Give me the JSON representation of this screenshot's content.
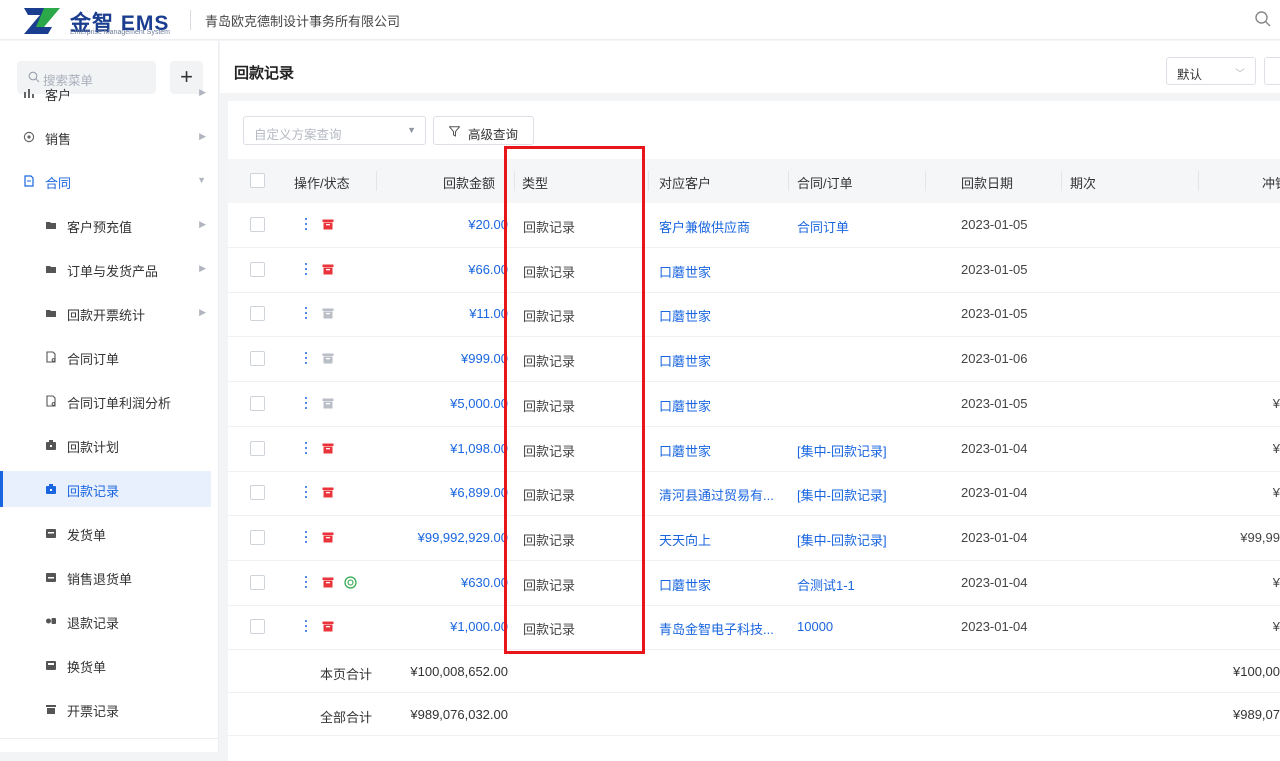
{
  "app": {
    "logo_title": "金智 EMS",
    "logo_subtitle": "Enterprise Management System",
    "company": "青岛欧克德制设计事务所有限公司"
  },
  "sidebar": {
    "search_placeholder": "搜索菜单",
    "items": [
      {
        "label": "客户",
        "level": 1,
        "icon": "customer-icon",
        "arrow": true
      },
      {
        "label": "销售",
        "level": 1,
        "icon": "sales-icon",
        "arrow": true
      },
      {
        "label": "合同",
        "level": 1,
        "icon": "contract-icon",
        "arrow": true,
        "expanded": true
      },
      {
        "label": "客户预充值",
        "level": 2,
        "icon": "folder-icon",
        "arrow": true
      },
      {
        "label": "订单与发货产品",
        "level": 2,
        "icon": "folder-icon",
        "arrow": true
      },
      {
        "label": "回款开票统计",
        "level": 2,
        "icon": "folder-icon",
        "arrow": true
      },
      {
        "label": "合同订单",
        "level": 2,
        "icon": "document-icon"
      },
      {
        "label": "合同订单利润分析",
        "level": 2,
        "icon": "document-icon"
      },
      {
        "label": "回款计划",
        "level": 2,
        "icon": "payment-plan-icon"
      },
      {
        "label": "回款记录",
        "level": 2,
        "icon": "payment-record-icon",
        "active": true
      },
      {
        "label": "发货单",
        "level": 2,
        "icon": "shipment-icon"
      },
      {
        "label": "销售退货单",
        "level": 2,
        "icon": "return-icon"
      },
      {
        "label": "退款记录",
        "level": 2,
        "icon": "refund-icon"
      },
      {
        "label": "换货单",
        "level": 2,
        "icon": "exchange-icon"
      },
      {
        "label": "开票记录",
        "level": 2,
        "icon": "invoice-icon"
      }
    ]
  },
  "page": {
    "title": "回款记录",
    "view_select": "默认",
    "filter_placeholder": "自定义方案查询",
    "advanced_search": "高级查询"
  },
  "table": {
    "headers": {
      "ops": "操作/状态",
      "amount": "回款金额",
      "type": "类型",
      "customer": "对应客户",
      "contract": "合同/订单",
      "date": "回款日期",
      "period": "期次",
      "offset": "冲销"
    },
    "rows": [
      {
        "amount": "¥20.00",
        "type": "回款记录",
        "customer": "客户兼做供应商",
        "contract": "合同订单",
        "date": "2023-01-05",
        "offset": "",
        "status": "red",
        "extra": false
      },
      {
        "amount": "¥66.00",
        "type": "回款记录",
        "customer": "口蘑世家",
        "contract": "",
        "date": "2023-01-05",
        "offset": "",
        "status": "red",
        "extra": false
      },
      {
        "amount": "¥11.00",
        "type": "回款记录",
        "customer": "口蘑世家",
        "contract": "",
        "date": "2023-01-05",
        "offset": "",
        "status": "gray",
        "extra": false
      },
      {
        "amount": "¥999.00",
        "type": "回款记录",
        "customer": "口蘑世家",
        "contract": "",
        "date": "2023-01-06",
        "offset": "",
        "status": "gray",
        "extra": false
      },
      {
        "amount": "¥5,000.00",
        "type": "回款记录",
        "customer": "口蘑世家",
        "contract": "",
        "date": "2023-01-05",
        "offset": "¥",
        "status": "gray",
        "extra": false
      },
      {
        "amount": "¥1,098.00",
        "type": "回款记录",
        "customer": "口蘑世家",
        "contract": "[集中-回款记录]",
        "date": "2023-01-04",
        "offset": "¥",
        "status": "red",
        "extra": false
      },
      {
        "amount": "¥6,899.00",
        "type": "回款记录",
        "customer": "清河县通过贸易有...",
        "contract": "[集中-回款记录]",
        "date": "2023-01-04",
        "offset": "¥",
        "status": "red",
        "extra": false
      },
      {
        "amount": "¥99,992,929.00",
        "type": "回款记录",
        "customer": "天天向上",
        "contract": "[集中-回款记录]",
        "date": "2023-01-04",
        "offset": "¥99,99",
        "status": "red",
        "extra": false
      },
      {
        "amount": "¥630.00",
        "type": "回款记录",
        "customer": "口蘑世家",
        "contract": "合测试1-1",
        "date": "2023-01-04",
        "offset": "¥",
        "status": "red",
        "extra": true
      },
      {
        "amount": "¥1,000.00",
        "type": "回款记录",
        "customer": "青岛金智电子科技...",
        "contract": "10000",
        "date": "2023-01-04",
        "offset": "¥",
        "status": "red",
        "extra": false
      }
    ],
    "page_total_label": "本页合计",
    "page_total": "¥100,008,652.00",
    "page_total_offset": "¥100,00",
    "all_total_label": "全部合计",
    "all_total": "¥989,076,032.00",
    "all_total_offset": "¥989,07"
  },
  "colors": {
    "accent": "#1a66e0",
    "status_red": "#e8343a",
    "status_gray": "#b9bec7",
    "highlight": "#e8161b"
  }
}
